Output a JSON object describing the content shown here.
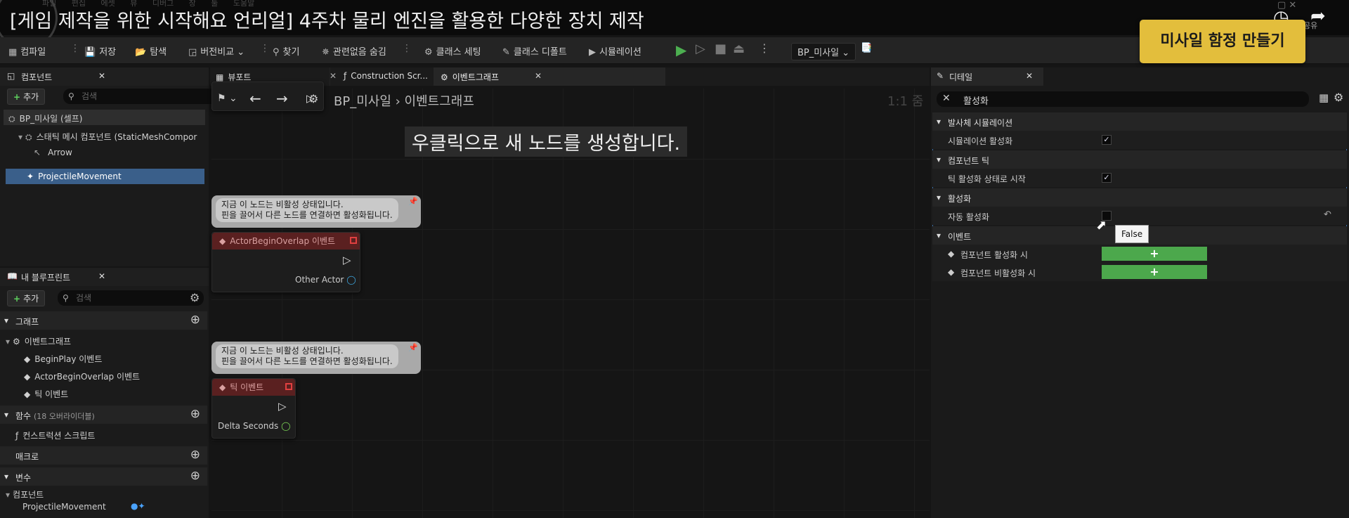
{
  "video": {
    "title": "[게임 제작을 위한 시작해요 언리얼] 4주차 물리 엔진을 활용한 다양한 장치 제작",
    "menu_ghost": "파일 편집 에셋 뷰 디버그 창 툴 도움말",
    "corner_partial": "공유",
    "banner": "미사일 함정 만들기"
  },
  "toolbar": {
    "compile": "컴파일",
    "save": "저장",
    "browse": "탐색",
    "diff": "버전비교",
    "find": "찾기",
    "hide_unrelated": "관련없음 숨김",
    "class_settings": "클래스 세팅",
    "class_defaults": "클래스 디폴트",
    "simulation": "시뮬레이션",
    "debug_target": "BP_미사일"
  },
  "components_panel": {
    "tab": "컴포넌트",
    "add": "추가",
    "search_placeholder": "검색",
    "root": "BP_미사일 (셀프)",
    "static_mesh": "스태틱 메시 컴포넌트 (StaticMeshCompor",
    "arrow": "Arrow",
    "projectile": "ProjectileMovement"
  },
  "blueprint_panel": {
    "tab": "내 블루프린트",
    "add": "추가",
    "search_placeholder": "검색",
    "graphs_header": "그래프",
    "event_graph": "이벤트그래프",
    "events": [
      "BeginPlay 이벤트",
      "ActorBeginOverlap 이벤트",
      "틱 이벤트"
    ],
    "functions_header": "함수",
    "functions_note": "(18 오버라이더블)",
    "construction_script": "컨스트럭션 스크립트",
    "macros_header": "매크로",
    "variables_header": "변수",
    "components_sub": "컴포넌트",
    "var_projectile": "ProjectileMovement"
  },
  "editor_tabs": {
    "viewport": "뷰포트",
    "construction": "Construction Scr...",
    "event_graph": "이벤트그래프"
  },
  "graph": {
    "breadcrumb_root": "BP_미사일",
    "breadcrumb_leaf": "이벤트그래프",
    "zoom": "1:1 줌",
    "hint": "우클릭으로 새 노드를 생성합니다.",
    "disabled_msg_line1": "지금 이 노드는 비활성 상태입니다.",
    "disabled_msg_line2": "핀을 끌어서 다른 노드를 연결하면 활성화됩니다.",
    "node_overlap_title": "ActorBeginOverlap 이벤트",
    "node_overlap_pin": "Other Actor",
    "node_tick_title": "틱 이벤트",
    "node_tick_pin": "Delta Seconds"
  },
  "details": {
    "tab": "디테일",
    "search_value": "활성화",
    "cat_launch_sim": "발사체 시뮬레이션",
    "prop_sim_enabled": "시뮬레이션 활성화",
    "cat_component_tick": "컴포넌트 틱",
    "prop_start_tick_enabled": "틱 활성화 상태로 시작",
    "cat_activation": "활성화",
    "prop_auto_activate": "자동 활성화",
    "tooltip": "False",
    "cat_events": "이벤트",
    "prop_on_activated": "컴포넌트 활성화 시",
    "prop_on_deactivated": "컴포넌트 비활성화 시",
    "add_symbol": "+"
  }
}
